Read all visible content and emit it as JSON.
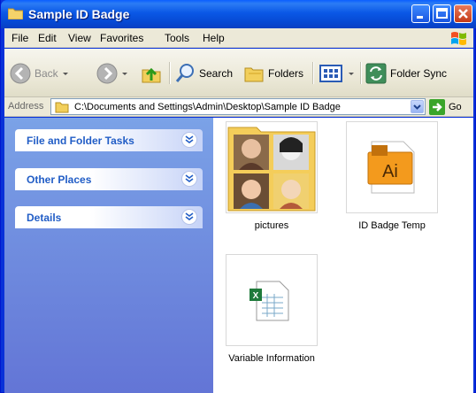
{
  "window": {
    "title": "Sample ID Badge"
  },
  "menu": [
    "File",
    "Edit",
    "View",
    "Favorites",
    "Tools",
    "Help"
  ],
  "toolbar": {
    "back_label": "Back",
    "search_label": "Search",
    "folders_label": "Folders",
    "foldersync_label": "Folder Sync"
  },
  "address": {
    "label": "Address",
    "value": "C:\\Documents and Settings\\Admin\\Desktop\\Sample ID Badge",
    "go_label": "Go"
  },
  "taskpane": {
    "panels": [
      {
        "label": "File and Folder Tasks"
      },
      {
        "label": "Other Places"
      },
      {
        "label": "Details"
      }
    ]
  },
  "files": [
    {
      "name": "pictures",
      "icon": "folder-with-photos-icon"
    },
    {
      "name": "ID Badge Temp",
      "icon": "illustrator-ai-file-icon"
    },
    {
      "name": "Variable Information",
      "icon": "excel-csv-file-icon"
    }
  ],
  "colors": {
    "titlebar": "#0a58e6",
    "taskpane": "#7ba2e7",
    "panel_text": "#215dc6"
  }
}
